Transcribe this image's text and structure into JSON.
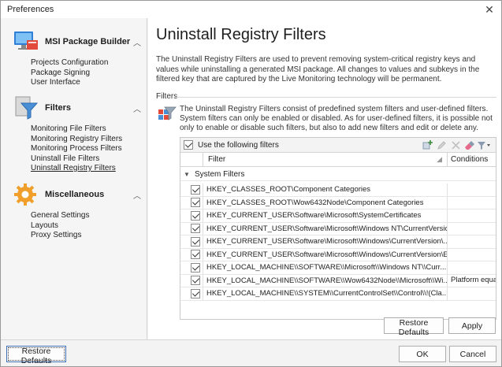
{
  "window": {
    "title": "Preferences"
  },
  "sidebar": {
    "sections": [
      {
        "title": "MSI Package Builder",
        "items": [
          "Projects Configuration",
          "Package Signing",
          "User Interface"
        ]
      },
      {
        "title": "Filters",
        "items": [
          "Monitoring File Filters",
          "Monitoring Registry Filters",
          "Monitoring Process Filters",
          "Uninstall File Filters",
          "Uninstall Registry Filters"
        ],
        "active_index": 4
      },
      {
        "title": "Miscellaneous",
        "items": [
          "General Settings",
          "Layouts",
          "Proxy Settings"
        ]
      }
    ]
  },
  "main": {
    "title": "Uninstall Registry Filters",
    "description": "The Uninstall Registry Filters are used to prevent removing system-critical registry keys and values while uninstalling a generated MSI package. All changes to values and subkeys in the filtered key that are captured by the Live Monitoring technology will be permanent.",
    "group_label": "Filters",
    "filters_description": "The Uninstall Registry Filters consist of predefined system filters and user-defined filters. System filters can only be enabled or disabled. As for user-defined filters, it is possible not only to enable or disable such filters, but also to add new filters and edit or delete any.",
    "grid": {
      "use_label": "Use the following filters",
      "use_checked": true,
      "columns": {
        "filter": "Filter",
        "conditions": "Conditions"
      },
      "group_name": "System Filters",
      "rows": [
        {
          "checked": true,
          "filter": "HKEY_CLASSES_ROOT\\Component Categories",
          "conditions": ""
        },
        {
          "checked": true,
          "filter": "HKEY_CLASSES_ROOT\\Wow6432Node\\Component Categories",
          "conditions": ""
        },
        {
          "checked": true,
          "filter": "HKEY_CURRENT_USER\\Software\\Microsoft\\SystemCertificates",
          "conditions": ""
        },
        {
          "checked": true,
          "filter": "HKEY_CURRENT_USER\\Software\\Microsoft\\Windows NT\\CurrentVersio...",
          "conditions": ""
        },
        {
          "checked": true,
          "filter": "HKEY_CURRENT_USER\\Software\\Microsoft\\Windows\\CurrentVersion\\...",
          "conditions": ""
        },
        {
          "checked": true,
          "filter": "HKEY_CURRENT_USER\\Software\\Microsoft\\Windows\\CurrentVersion\\E...",
          "conditions": ""
        },
        {
          "checked": true,
          "filter": "HKEY_LOCAL_MACHINE\\\\SOFTWARE\\\\Microsoft\\\\Windows NT\\\\Curr...",
          "conditions": ""
        },
        {
          "checked": true,
          "filter": "HKEY_LOCAL_MACHINE\\\\SOFTWARE\\\\Wow6432Node\\\\Microsoft\\\\Wi...",
          "conditions": "Platform equa"
        },
        {
          "checked": true,
          "filter": "HKEY_LOCAL_MACHINE\\\\SYSTEM\\\\CurrentControlSet\\\\Control\\\\!(Cla...",
          "conditions": ""
        }
      ]
    },
    "buttons": {
      "restore_defaults": "Restore Defaults",
      "apply": "Apply"
    }
  },
  "footer": {
    "restore_defaults": "Restore Defaults",
    "ok": "OK",
    "cancel": "Cancel"
  },
  "colors": {
    "accent": "#3c6fb5",
    "filters_icon_blue": "#4a8fd6",
    "gear_orange": "#f0a02a"
  }
}
